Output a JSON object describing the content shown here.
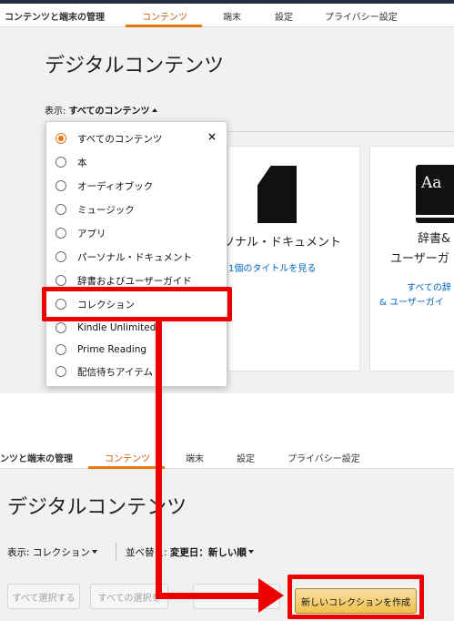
{
  "top_nav": {
    "manage_label": "コンテンツと端末の管理",
    "tabs": [
      "コンテンツ",
      "端末",
      "設定",
      "プライバシー設定"
    ]
  },
  "top_page": {
    "title": "デジタルコンテンツ",
    "show_label": "表示:",
    "show_value": "すべてのコンテンツ",
    "dropdown_items": [
      "すべてのコンテンツ",
      "本",
      "オーディオブック",
      "ミュージック",
      "アプリ",
      "パーソナル・ドキュメント",
      "辞書およびユーザーガイド",
      "コレクション",
      "Kindle Unlimited",
      "Prime Reading",
      "配信待ちアイテム"
    ],
    "close_glyph": "×",
    "cards": [
      {
        "title": "ソナル・ドキュメント",
        "link": "1個のタイトルを見る",
        "icon": "document-icon"
      },
      {
        "title_line1": "辞書&",
        "title_line2": "ユーザーガ",
        "link_line1": "すべての辞",
        "link_line2": "& ユーザーガイ",
        "icon": "book-aa-icon",
        "icon_text": "Aa"
      }
    ]
  },
  "bottom_nav": {
    "manage_label": "ンツと端末の管理",
    "tabs": [
      "コンテンツ",
      "端末",
      "設定",
      "プライバシー設定"
    ]
  },
  "bottom_page": {
    "title": "デジタルコンテンツ",
    "show_label": "表示:",
    "show_value": "コレクション",
    "sort_label": "並べ替え:",
    "sort_value": "変更日：新しい順",
    "buttons": {
      "select_all": "すべて選択する",
      "deselect_all": "すべての選択を",
      "new_collection": "新しいコレクションを作成"
    }
  },
  "colors": {
    "accent": "#e47911",
    "annotation_red": "#ee0000",
    "link": "#0066c0",
    "primary_button": "#f0c14b"
  }
}
